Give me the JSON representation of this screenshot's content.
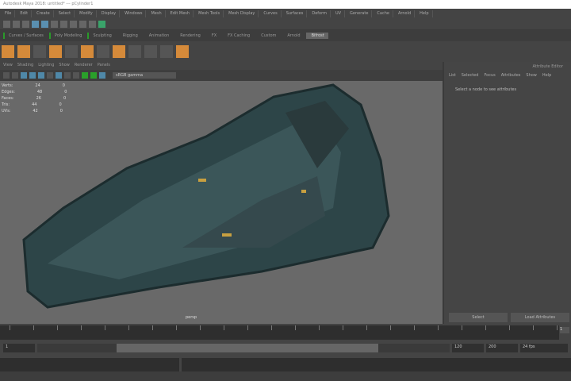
{
  "title": "Autodesk Maya 2018: untitled* --- pCylinder1",
  "menu": [
    "File",
    "Edit",
    "Create",
    "Select",
    "Modify",
    "Display",
    "Windows",
    "Mesh",
    "Edit Mesh",
    "Mesh Tools",
    "Mesh Display",
    "Curves",
    "Surfaces",
    "Deform",
    "UV",
    "Generate",
    "Cache",
    "Arnold",
    "Help"
  ],
  "shelf_tabs": [
    "Curves / Surfaces",
    "Poly Modeling",
    "Sculpting",
    "Rigging",
    "Animation",
    "Rendering",
    "FX",
    "FX Caching",
    "Custom",
    "Arnold",
    "Bifrost"
  ],
  "active_shelf_tab": "Bifrost",
  "panel_menu": [
    "View",
    "Shading",
    "Lighting",
    "Show",
    "Renderer",
    "Panels"
  ],
  "camera_field": "sRGB gamma",
  "hud": [
    [
      "Verts:",
      "24",
      "0"
    ],
    [
      "Edges:",
      "48",
      "0"
    ],
    [
      "Faces:",
      "26",
      "0"
    ],
    [
      "Tris:",
      "44",
      "0"
    ],
    [
      "UVs:",
      "42",
      "0"
    ]
  ],
  "viewport_label": "persp",
  "right_panel": {
    "title": "Attribute Editor",
    "tabs": [
      "List",
      "Selected",
      "Focus",
      "Attributes",
      "Show",
      "Help"
    ],
    "message": "Select a node to see attributes",
    "buttons": [
      "Select",
      "Load Attributes"
    ]
  },
  "time": {
    "current": "1",
    "start": "1",
    "end": "120",
    "range_start_label": "1",
    "range_end_label": "120",
    "anim_end": "200",
    "fps": "24 fps"
  },
  "colors": {
    "viewport": "#696969",
    "object": "#2d4548",
    "accent": "#5a8fb0"
  }
}
